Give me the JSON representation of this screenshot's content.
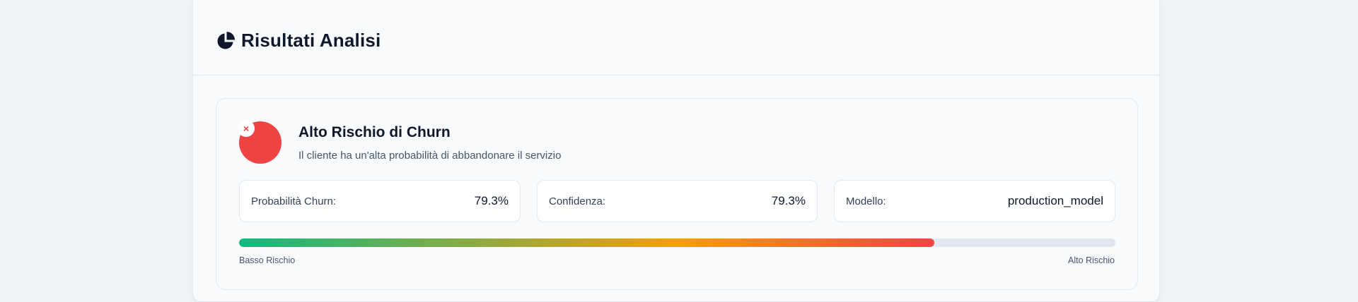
{
  "header": {
    "title": "Risultati Analisi",
    "icon": "chart-pie-icon"
  },
  "result": {
    "status_icon": "x-circle-icon",
    "status_mark": "×",
    "title": "Alto Rischio di Churn",
    "description": "Il cliente ha un'alta probabilità di abbandonare il servizio",
    "status_color": "#ef4444"
  },
  "metrics": [
    {
      "label": "Probabilità Churn:",
      "value": "79.3%"
    },
    {
      "label": "Confidenza:",
      "value": "79.3%"
    },
    {
      "label": "Modello:",
      "value": "production_model"
    }
  ],
  "risk_bar": {
    "fraction": 0.793,
    "low_label": "Basso Rischio",
    "high_label": "Alto Rischio",
    "gradient_colors": [
      "#10b981",
      "#f59e0b",
      "#ef4444"
    ],
    "track_color": "#e2e8f0"
  }
}
